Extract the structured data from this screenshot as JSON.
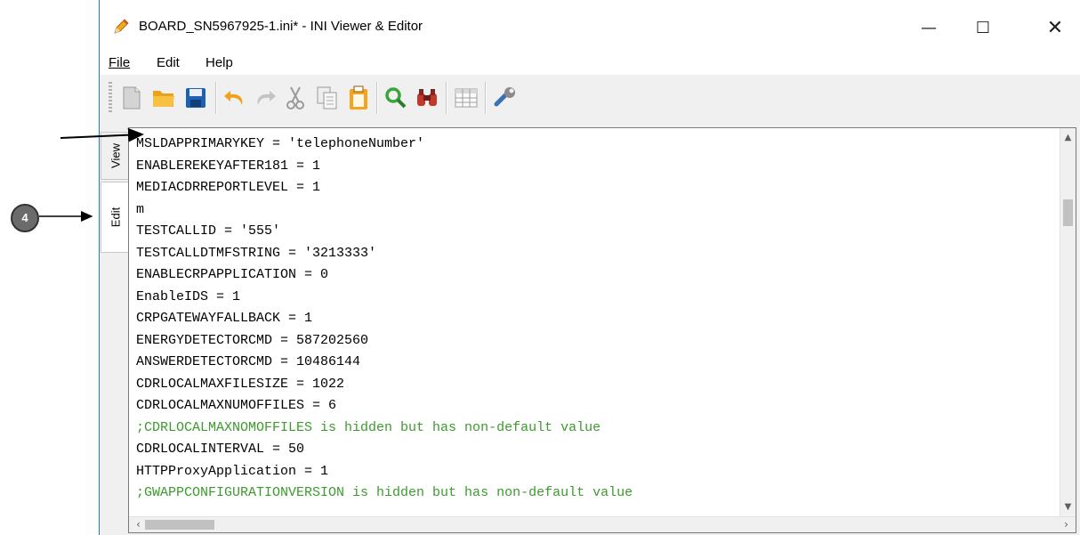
{
  "window": {
    "title": "BOARD_SN5967925-1.ini* - INI Viewer & Editor",
    "controls": {
      "minimize": "—",
      "maximize": "☐",
      "close": "✕"
    }
  },
  "menu": {
    "file": "File",
    "edit": "Edit",
    "help": "Help"
  },
  "toolbar": {
    "icons": [
      "new-file-icon",
      "open-folder-icon",
      "save-icon",
      "undo-icon",
      "redo-icon",
      "cut-icon",
      "copy-icon",
      "paste-icon",
      "find-icon",
      "find-next-icon",
      "table-icon",
      "settings-wrench-icon"
    ]
  },
  "tabs": {
    "view": "View",
    "edit": "Edit"
  },
  "editor": {
    "lines": [
      {
        "text": "MSLDAPPRIMARYKEY = 'telephoneNumber'"
      },
      {
        "text": "ENABLEREKEYAFTER181 = 1"
      },
      {
        "text": "MEDIACDRREPORTLEVEL = 1"
      },
      {
        "text": "m"
      },
      {
        "text": "TESTCALLID = '555'"
      },
      {
        "text": "TESTCALLDTMFSTRING = '3213333'"
      },
      {
        "text": "ENABLECRPAPPLICATION = 0"
      },
      {
        "text": "EnableIDS = 1"
      },
      {
        "text": "CRPGATEWAYFALLBACK = 1"
      },
      {
        "text": "ENERGYDETECTORCMD = 587202560"
      },
      {
        "text": "ANSWERDETECTORCMD = 10486144"
      },
      {
        "text": "CDRLOCALMAXFILESIZE = 1022"
      },
      {
        "text": "CDRLOCALMAXNUMOFFILES = 6"
      },
      {
        "text": ";CDRLOCALMAXNOMOFFILES is hidden but has non-default value"
      },
      {
        "text": "CDRLOCALINTERVAL = 50"
      },
      {
        "text": "HTTPProxyApplication = 1"
      },
      {
        "text": ";GWAPPCONFIGURATIONVERSION is hidden but has non-default value"
      }
    ],
    "comment_color": "#3d9a2e"
  },
  "annotation": {
    "callout_number": "4"
  }
}
